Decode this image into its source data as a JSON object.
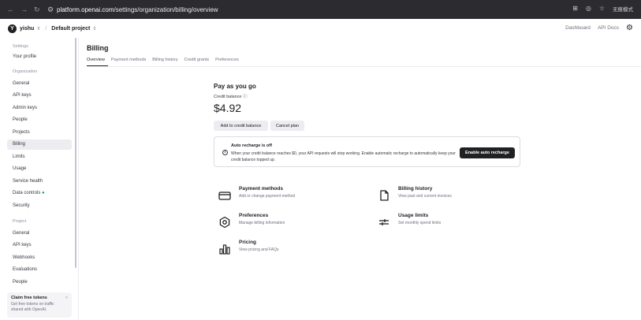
{
  "browser": {
    "url_domain": "platform.openai.com",
    "url_path": "/settings/organization/billing/overview",
    "right_label": "无痕模式"
  },
  "header": {
    "avatar_letter": "Y",
    "org": "yishu",
    "project": "Default project",
    "links": [
      "Dashboard",
      "API Docs"
    ]
  },
  "sidebar": {
    "settings": "Settings",
    "your_profile": "Your profile",
    "organization": "Organization",
    "org_items": [
      "General",
      "API keys",
      "Admin keys",
      "People",
      "Projects",
      "Billing",
      "Limits",
      "Usage",
      "Service health",
      "Data controls",
      "Security"
    ],
    "data_controls_dot": "●",
    "project": "Project",
    "project_items": [
      "General",
      "API keys",
      "Webhooks",
      "Evaluations",
      "People"
    ],
    "claim_title": "Claim free tokens",
    "claim_desc": "Get free tokens on traffic shared with OpenAI.",
    "claim_close": "×"
  },
  "page": {
    "title": "Billing",
    "tabs": [
      "Overview",
      "Payment methods",
      "Billing history",
      "Credit grants",
      "Preferences"
    ]
  },
  "billing": {
    "heading": "Pay as you go",
    "credit_label": "Credit balance ⓘ",
    "balance": "$4.92",
    "add_btn": "Add to credit balance",
    "cancel_btn": "Cancel plan",
    "alert_title": "Auto recharge is off",
    "alert_desc": "When your credit balance reaches $0, your API requests will stop working. Enable automatic recharge to automatically keep your credit balance topped up.",
    "enable_btn": "Enable auto recharge"
  },
  "cards": [
    {
      "title": "Payment methods",
      "desc": "Add or change payment method",
      "icon": "credit-card-icon"
    },
    {
      "title": "Billing history",
      "desc": "View past and current invoices",
      "icon": "document-icon"
    },
    {
      "title": "Preferences",
      "desc": "Manage billing information",
      "icon": "gear-icon"
    },
    {
      "title": "Usage limits",
      "desc": "Set monthly spend limits",
      "icon": "sliders-icon"
    },
    {
      "title": "Pricing",
      "desc": "View pricing and FAQs",
      "icon": "pricing-chart-icon"
    }
  ]
}
